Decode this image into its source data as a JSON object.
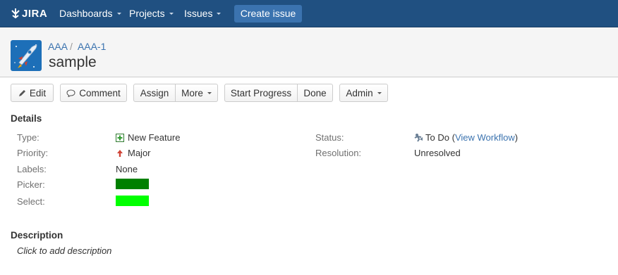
{
  "nav": {
    "logo_text": "JIRA",
    "dashboards": "Dashboards",
    "projects": "Projects",
    "issues": "Issues",
    "create_issue": "Create issue"
  },
  "issue": {
    "breadcrumb_project": "AAA",
    "breadcrumb_key": "AAA-1",
    "summary": "sample"
  },
  "toolbar": {
    "edit": "Edit",
    "comment": "Comment",
    "assign": "Assign",
    "more": "More",
    "start_progress": "Start Progress",
    "done": "Done",
    "admin": "Admin"
  },
  "details": {
    "title": "Details",
    "type_label": "Type:",
    "type_value": "New Feature",
    "priority_label": "Priority:",
    "priority_value": "Major",
    "labels_label": "Labels:",
    "labels_value": "None",
    "picker_label": "Picker:",
    "picker_color": "#008000",
    "select_label": "Select:",
    "select_color": "#00ff00",
    "status_label": "Status:",
    "status_value": "To Do",
    "status_open_paren": "(",
    "view_workflow": "View Workflow",
    "status_close_paren": ")",
    "resolution_label": "Resolution:",
    "resolution_value": "Unresolved"
  },
  "description": {
    "title": "Description",
    "placeholder": "Click to add description"
  },
  "icons": {
    "type": "new-feature-icon",
    "priority": "major-priority-arrow-icon",
    "status": "to-do-status-icon",
    "edit": "pencil-icon",
    "comment": "speech-bubble-icon"
  },
  "colors": {
    "topbar": "#205081",
    "create_button": "#3b73af",
    "link": "#3b73af"
  }
}
